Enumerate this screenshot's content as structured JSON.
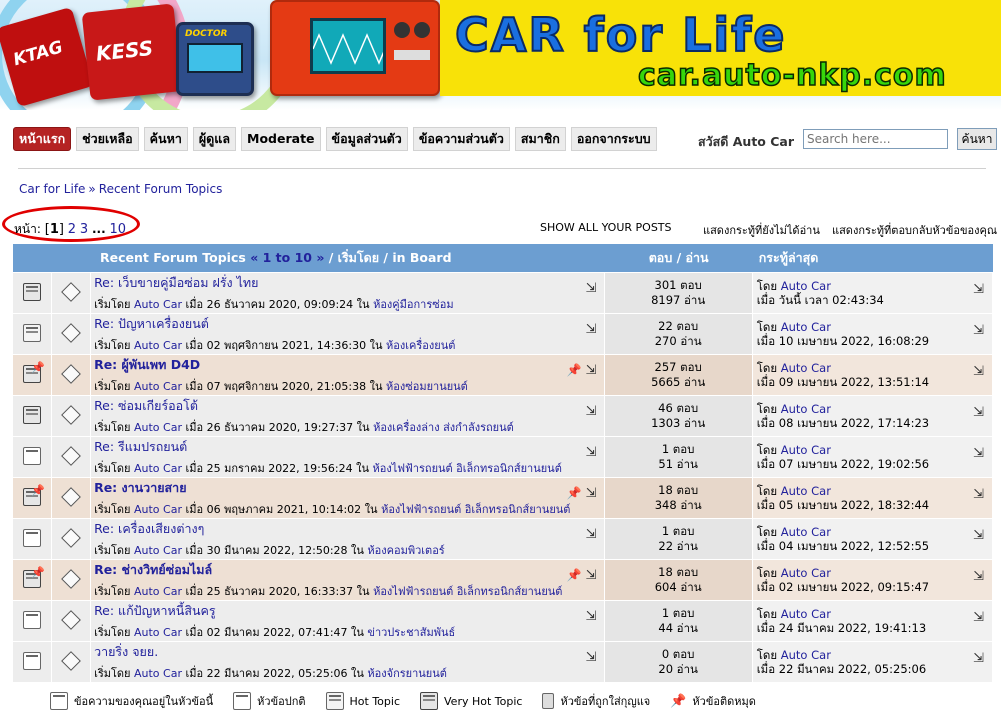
{
  "banner": {
    "title": "CAR for Life",
    "url": "car.auto-nkp.com",
    "device1": "KTAG",
    "device2": "KESS",
    "device3": "DOCTOR"
  },
  "nav": {
    "items": [
      "หน้าแรก",
      "ช่วยเหลือ",
      "ค้นหา",
      "ผู้ดูแล",
      "Moderate",
      "ข้อมูลส่วนตัว",
      "ข้อความส่วนตัว",
      "สมาชิก",
      "ออกจากระบบ"
    ],
    "greeting": "สวัสดี Auto Car",
    "search_placeholder": "Search here...",
    "search_button": "ค้นหา"
  },
  "breadcrumb": {
    "root": "Car for Life",
    "sep": "»",
    "current": "Recent Forum Topics"
  },
  "pagination": {
    "label": "หน้า:",
    "current": "1",
    "pages": [
      "2",
      "3"
    ],
    "dots": "...",
    "last": "10"
  },
  "top_links": [
    "SHOW ALL YOUR POSTS",
    "แสดงกระทู้ที่ยังไม่ได้อ่าน",
    "แสดงกระทู้ที่ตอบกลับหัวข้อของคุณ"
  ],
  "table": {
    "head_topic": "Recent Forum Topics",
    "head_range": "« 1 to 10 »",
    "head_tail": "/ เริ่มโดย / in Board",
    "head_counts": "ตอบ / อ่าน",
    "head_last": "กระทู้ล่าสุด",
    "started_by": "เริ่มโดย",
    "on_word": "เมื่อ",
    "in_word": "ใน",
    "by_word": "โดย",
    "rows": [
      {
        "title": "Re: เว็บขายคู่มือซ่อม ฝรั่ง ไทย",
        "author": "Auto Car",
        "date": "26 ธันวาคม 2020, 09:09:24",
        "board": "ห้องคู่มือการซ่อม",
        "replies": "301 ตอบ",
        "views": "8197 อ่าน",
        "last_by": "Auto Car",
        "last_date": "วันนี้ เวลา 02:43:34",
        "sticky": false,
        "icon": "veryhot"
      },
      {
        "title": "Re: ปัญหาเครื่องยนต์",
        "author": "Auto Car",
        "date": "02 พฤศจิกายน 2021, 14:36:30",
        "board": "ห้องเครื่องยนต์",
        "replies": "22 ตอบ",
        "views": "270 อ่าน",
        "last_by": "Auto Car",
        "last_date": "10 เมษายน 2022, 16:08:29",
        "sticky": false,
        "icon": "hot"
      },
      {
        "title": "Re: ผู้พันเพท D4D",
        "author": "Auto Car",
        "date": "07 พฤศจิกายน 2020, 21:05:38",
        "board": "ห้องซ่อมยานยนต์",
        "replies": "257 ตอบ",
        "views": "5665 อ่าน",
        "last_by": "Auto Car",
        "last_date": "09 เมษายน 2022, 13:51:14",
        "sticky": true,
        "icon": "veryhot"
      },
      {
        "title": "Re: ซ่อมเกียร์ออโต้",
        "author": "Auto Car",
        "date": "26 ธันวาคม 2020, 19:27:37",
        "board": "ห้องเครื่องล่าง ส่งกำลังรถยนต์",
        "replies": "46 ตอบ",
        "views": "1303 อ่าน",
        "last_by": "Auto Car",
        "last_date": "08 เมษายน 2022, 17:14:23",
        "sticky": false,
        "icon": "veryhot"
      },
      {
        "title": "Re: รีแมปรถยนต์",
        "author": "Auto Car",
        "date": "25 มกราคม 2022, 19:56:24",
        "board": "ห้องไฟฟ้ารถยนต์ อิเล็กทรอนิกส์ยานยนต์",
        "replies": "1 ตอบ",
        "views": "51 อ่าน",
        "last_by": "Auto Car",
        "last_date": "07 เมษายน 2022, 19:02:56",
        "sticky": false,
        "icon": "normal"
      },
      {
        "title": "Re: งานวายสาย",
        "author": "Auto Car",
        "date": "06 พฤษภาคม 2021, 10:14:02",
        "board": "ห้องไฟฟ้ารถยนต์ อิเล็กทรอนิกส์ยานยนต์",
        "replies": "18 ตอบ",
        "views": "348 อ่าน",
        "last_by": "Auto Car",
        "last_date": "05 เมษายน 2022, 18:32:44",
        "sticky": true,
        "icon": "veryhot"
      },
      {
        "title": "Re: เครื่องเสียงต่างๆ",
        "author": "Auto Car",
        "date": "30 มีนาคม 2022, 12:50:28",
        "board": "ห้องคอมพิวเตอร์",
        "replies": "1 ตอบ",
        "views": "22 อ่าน",
        "last_by": "Auto Car",
        "last_date": "04 เมษายน 2022, 12:52:55",
        "sticky": false,
        "icon": "normal"
      },
      {
        "title": "Re: ช่างวิทย์ซ่อมไมล์",
        "author": "Auto Car",
        "date": "25 ธันวาคม 2020, 16:33:37",
        "board": "ห้องไฟฟ้ารถยนต์ อิเล็กทรอนิกส์ยานยนต์",
        "replies": "18 ตอบ",
        "views": "604 อ่าน",
        "last_by": "Auto Car",
        "last_date": "02 เมษายน 2022, 09:15:47",
        "sticky": true,
        "icon": "veryhot"
      },
      {
        "title": "Re: แก้ปัญหาหนี้สินครู",
        "author": "Auto Car",
        "date": "02 มีนาคม 2022, 07:41:47",
        "board": "ข่าวประชาสัมพันธ์",
        "replies": "1 ตอบ",
        "views": "44 อ่าน",
        "last_by": "Auto Car",
        "last_date": "24 มีนาคม 2022, 19:41:13",
        "sticky": false,
        "icon": "normal"
      },
      {
        "title": "วายริ่ง จยย.",
        "author": "Auto Car",
        "date": "22 มีนาคม 2022, 05:25:06",
        "board": "ห้องจักรยานยนต์",
        "replies": "0 ตอบ",
        "views": "20 อ่าน",
        "last_by": "Auto Car",
        "last_date": "22 มีนาคม 2022, 05:25:06",
        "sticky": false,
        "icon": "normal"
      }
    ]
  },
  "legend": [
    "ข้อความของคุณอยู่ในหัวข้อนี้",
    "หัวข้อปกติ",
    "Hot Topic",
    "Very Hot Topic",
    "หัวข้อที่ถูกใส่กุญแจ",
    "หัวข้อติดหมุด"
  ]
}
